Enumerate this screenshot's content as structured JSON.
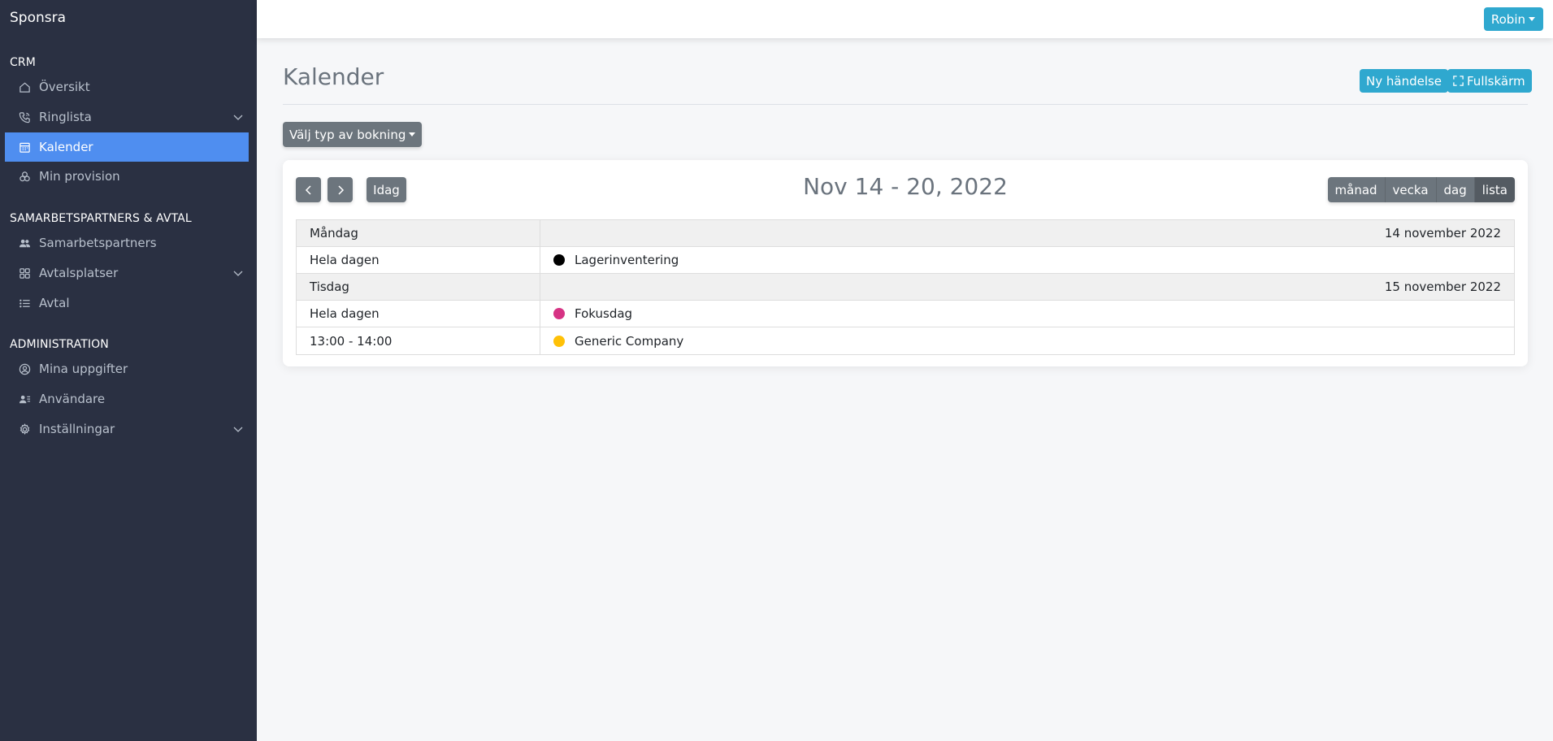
{
  "sidebar": {
    "brand": "Sponsra",
    "sections": {
      "crm": "CRM",
      "partners": "SAMARBETSPARTNERS & AVTAL",
      "admin": "ADMINISTRATION"
    },
    "items": {
      "oversikt": "Översikt",
      "ringlista": "Ringlista",
      "kalender": "Kalender",
      "min_provision": "Min provision",
      "samarbetspartners": "Samarbetspartners",
      "avtalsplatser": "Avtalsplatser",
      "avtal": "Avtal",
      "mina_uppgifter": "Mina uppgifter",
      "anvandare": "Användare",
      "installningar": "Inställningar"
    }
  },
  "topbar": {
    "user": "Robin"
  },
  "page": {
    "title": "Kalender",
    "new_event": "Ny händelse",
    "fullscreen": "Fullskärm",
    "booking_type": "Välj typ av bokning"
  },
  "calendar": {
    "today": "Idag",
    "range": "Nov 14 - 20, 2022",
    "views": {
      "month": "månad",
      "week": "vecka",
      "day": "dag",
      "list": "lista"
    },
    "days": [
      {
        "name": "Måndag",
        "date": "14 november 2022",
        "events": [
          {
            "time": "Hela dagen",
            "title": "Lagerinventering",
            "color": "#000000"
          }
        ]
      },
      {
        "name": "Tisdag",
        "date": "15 november 2022",
        "events": [
          {
            "time": "Hela dagen",
            "title": "Fokusdag",
            "color": "#d63384"
          },
          {
            "time": "13:00 - 14:00",
            "title": "Generic Company",
            "color": "#ffc107"
          }
        ]
      }
    ]
  }
}
